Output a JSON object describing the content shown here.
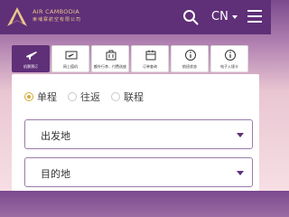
{
  "header": {
    "brand_en": "AIR CAMBODIA",
    "brand_cn": "柬埔寨航空有限公司",
    "lang_label": "CN"
  },
  "tabs": [
    {
      "label": "机票预订",
      "icon": "plane-icon",
      "active": true
    },
    {
      "label": "网上值机",
      "icon": "boarding-pass-icon",
      "active": false
    },
    {
      "label": "额外行李、付费选座",
      "icon": "luggage-icon",
      "active": false
    },
    {
      "label": "订单查询",
      "icon": "calendar-icon",
      "active": false
    },
    {
      "label": "航班状态",
      "icon": "info-icon",
      "active": false
    },
    {
      "label": "电子入境卡",
      "icon": "info-icon",
      "active": false
    }
  ],
  "trip_types": [
    {
      "label": "单程",
      "selected": true
    },
    {
      "label": "往返",
      "selected": false
    },
    {
      "label": "联程",
      "selected": false
    }
  ],
  "fields": {
    "origin_label": "出发地",
    "destination_label": "目的地"
  },
  "colors": {
    "brand_purple": "#5f2f78",
    "accent_gold": "#d7a93a",
    "field_border": "#9b7cac"
  }
}
